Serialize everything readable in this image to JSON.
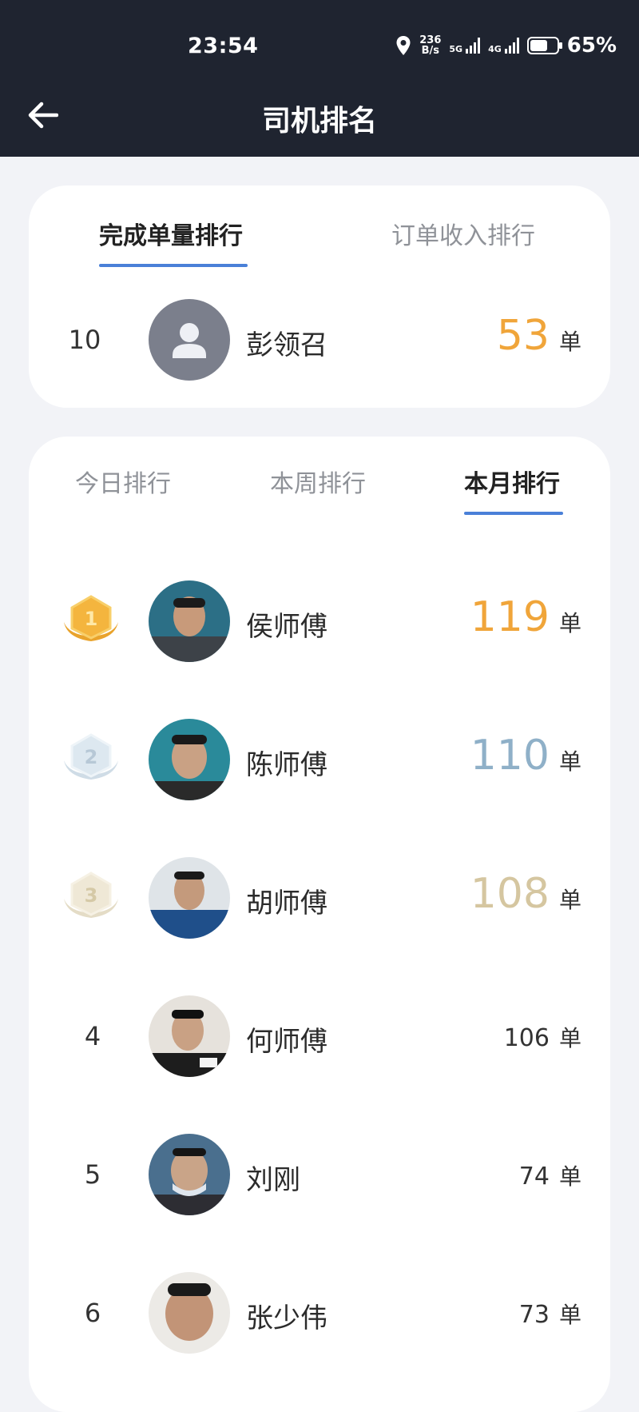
{
  "status": {
    "time": "23:54",
    "net_speed_top": "236",
    "net_speed_bottom": "B/s",
    "net_5g": "5G",
    "net_4g": "4G",
    "battery": "65%"
  },
  "nav": {
    "title": "司机排名"
  },
  "ranking_type_tabs": [
    {
      "label": "完成单量排行",
      "active": true
    },
    {
      "label": "订单收入排行",
      "active": false
    }
  ],
  "my_rank": {
    "rank": "10",
    "name": "彭领召",
    "count": "53",
    "unit": "单"
  },
  "period_tabs": [
    {
      "label": "今日排行",
      "active": false
    },
    {
      "label": "本周排行",
      "active": false
    },
    {
      "label": "本月排行",
      "active": true
    }
  ],
  "rankings": [
    {
      "rank": "1",
      "name": "侯师傅",
      "count": "119",
      "unit": "单",
      "badge": "gold-medal-icon"
    },
    {
      "rank": "2",
      "name": "陈师傅",
      "count": "110",
      "unit": "单",
      "badge": "silver-medal-icon"
    },
    {
      "rank": "3",
      "name": "胡师傅",
      "count": "108",
      "unit": "单",
      "badge": "bronze-medal-icon"
    },
    {
      "rank": "4",
      "name": "何师傅",
      "count": "106",
      "unit": "单"
    },
    {
      "rank": "5",
      "name": "刘刚",
      "count": "74",
      "unit": "单"
    },
    {
      "rank": "6",
      "name": "张少伟",
      "count": "73",
      "unit": "单"
    }
  ],
  "colors": {
    "header_bg": "#1f2430",
    "accent_underline": "#4a80d8",
    "gold": "#f0a53a",
    "silver": "#8fb0c8",
    "bronze": "#d5c6a0"
  }
}
